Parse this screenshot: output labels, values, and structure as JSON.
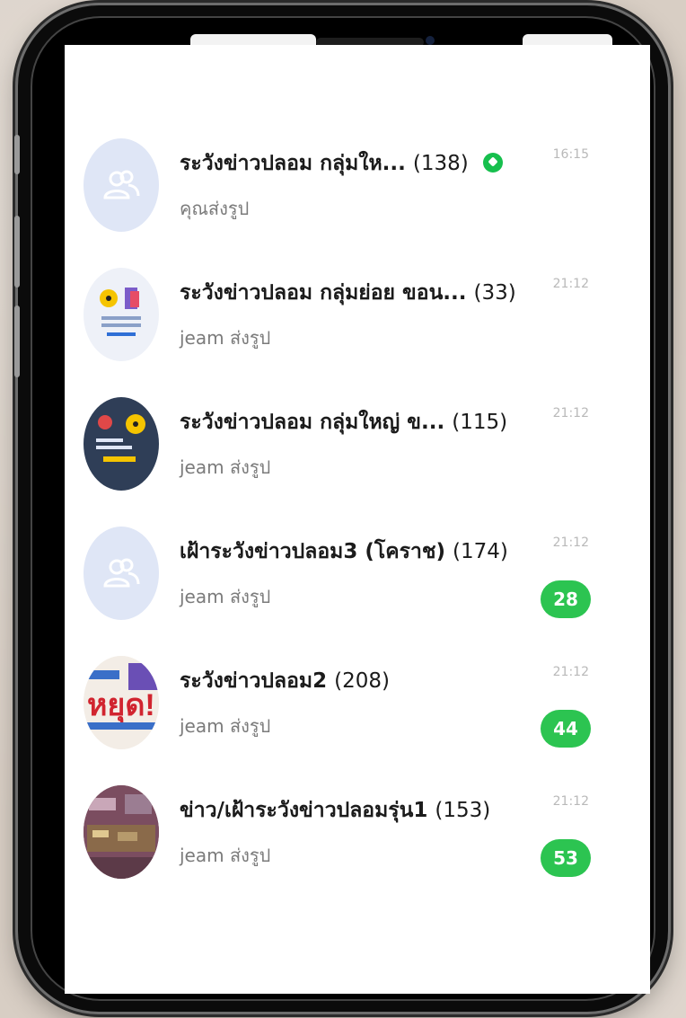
{
  "chats": [
    {
      "title": "ระวังข่าวปลอม กลุ่มให...",
      "count": "(138)",
      "subtitle": "คุณส่งรูป",
      "time": "16:15",
      "badge": "",
      "has_status_icon": true,
      "avatar": "group-placeholder"
    },
    {
      "title": "ระวังข่าวปลอม กลุ่มย่อย ขอน...",
      "count": "(33)",
      "subtitle": "jeam ส่งรูป",
      "time": "21:12",
      "badge": "",
      "has_status_icon": false,
      "avatar": "group-logo-light"
    },
    {
      "title": "ระวังข่าวปลอม กลุ่มใหญ่ ข...",
      "count": "(115)",
      "subtitle": "jeam ส่งรูป",
      "time": "21:12",
      "badge": "",
      "has_status_icon": false,
      "avatar": "group-logo-dark"
    },
    {
      "title": "เฝ้าระวังข่าวปลอม3 (โคราช)",
      "count": "(174)",
      "subtitle": "jeam ส่งรูป",
      "time": "21:12",
      "badge": "28",
      "has_status_icon": false,
      "avatar": "group-placeholder"
    },
    {
      "title": "ระวังข่าวปลอม2",
      "count": "(208)",
      "subtitle": "jeam ส่งรูป",
      "time": "21:12",
      "badge": "44",
      "has_status_icon": false,
      "avatar": "stop-sign-photo"
    },
    {
      "title": "ข่าว/เฝ้าระวังข่าวปลอมรุ่น1",
      "count": "(153)",
      "subtitle": "jeam ส่งรูป",
      "time": "21:12",
      "badge": "53",
      "has_status_icon": false,
      "avatar": "group-photo"
    }
  ],
  "colors": {
    "badge": "#2cc451",
    "status_icon": "#16bf4d",
    "time": "#b9b9b9"
  },
  "avatar_texts": {
    "stop_sign": "หยุด!"
  }
}
